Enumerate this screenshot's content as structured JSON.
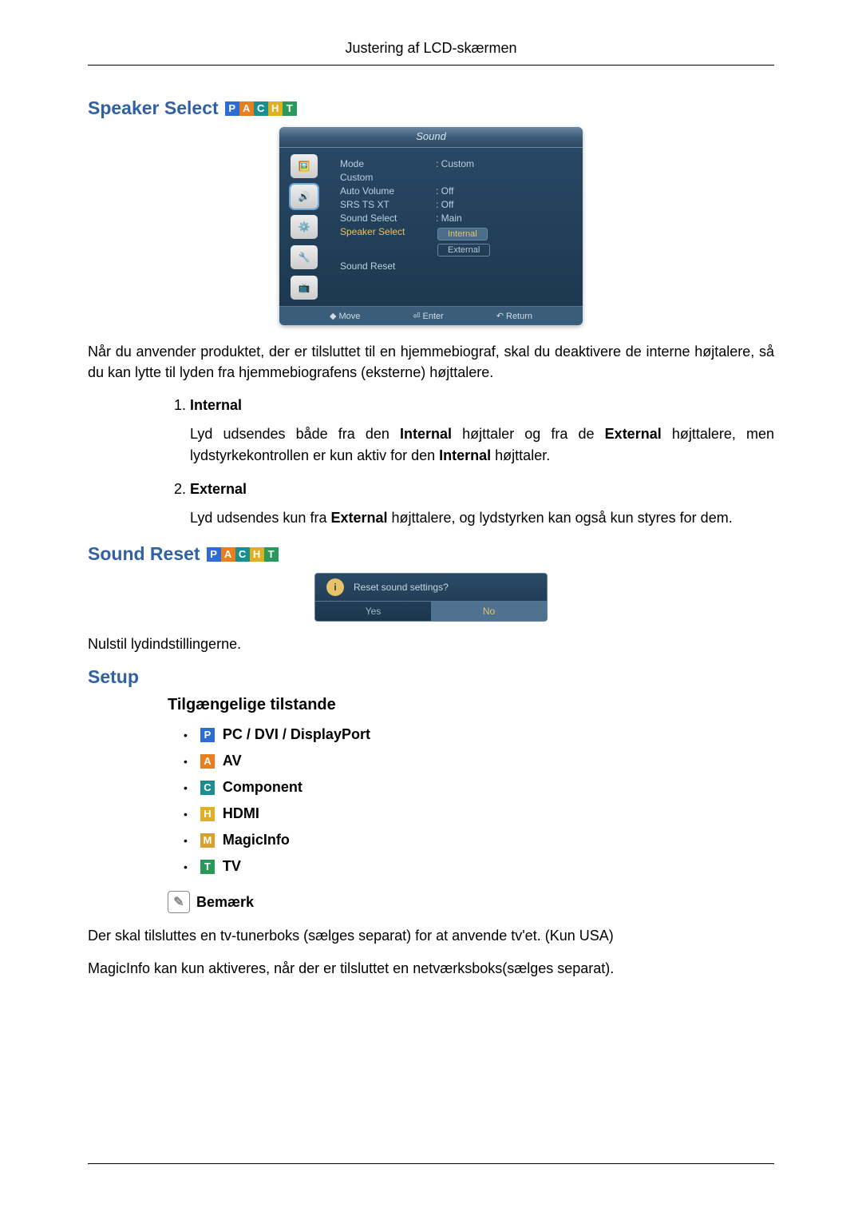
{
  "page_header": "Justering af LCD-skærmen",
  "sections": {
    "speaker_select": {
      "title": "Speaker Select",
      "intro": "Når du anvender produktet, der er tilsluttet til en hjemmebiograf, skal du deaktivere de interne højtalere, så du kan lytte til lyden fra hjemmebiografens (eksterne) højttalere.",
      "items": [
        {
          "title": "Internal",
          "body_pre": "Lyd udsendes både fra den ",
          "body_b1": "Internal",
          "body_mid": " højttaler og fra de ",
          "body_b2": "External",
          "body_mid2": " højttalere, men lydstyrkekontrollen er kun aktiv for den ",
          "body_b3": "Internal",
          "body_post": " højttaler."
        },
        {
          "title": "External",
          "body_pre": "Lyd udsendes kun fra ",
          "body_b1": "External",
          "body_post": " højttalere, og lydstyrken kan også kun styres for dem."
        }
      ]
    },
    "sound_reset": {
      "title": "Sound Reset",
      "body": "Nulstil lydindstillingerne."
    },
    "setup": {
      "title": "Setup",
      "sub_title": "Tilgængelige tilstande",
      "modes": {
        "pc": "PC / DVI / DisplayPort",
        "av": "AV",
        "component": "Component",
        "hdmi": "HDMI",
        "magicinfo": "MagicInfo",
        "tv": "TV"
      },
      "note_label": "Bemærk",
      "note1": "Der skal tilsluttes en tv-tunerboks (sælges separat) for at anvende tv'et. (Kun USA)",
      "note2": "MagicInfo kan kun aktiveres, når der er tilsluttet en netværksboks(sælges separat)."
    }
  },
  "osd1": {
    "title": "Sound",
    "rows": {
      "mode": {
        "label": "Mode",
        "value": ": Custom"
      },
      "custom": {
        "label": "Custom",
        "value": ""
      },
      "auto_volume": {
        "label": "Auto Volume",
        "value": ": Off"
      },
      "srs": {
        "label": "SRS TS XT",
        "value": ": Off"
      },
      "sound_select": {
        "label": "Sound Select",
        "value": ": Main"
      },
      "speaker_select": {
        "label": "Speaker Select",
        "value": ""
      },
      "sound_reset": {
        "label": "Sound Reset",
        "value": ""
      }
    },
    "options": {
      "internal": "Internal",
      "external": "External"
    },
    "footer": {
      "move": "Move",
      "enter": "Enter",
      "return": "Return"
    }
  },
  "osd2": {
    "question": "Reset sound settings?",
    "yes": "Yes",
    "no": "No"
  },
  "badges": {
    "p": "P",
    "a": "A",
    "c": "C",
    "h": "H",
    "m": "M",
    "t": "T"
  }
}
